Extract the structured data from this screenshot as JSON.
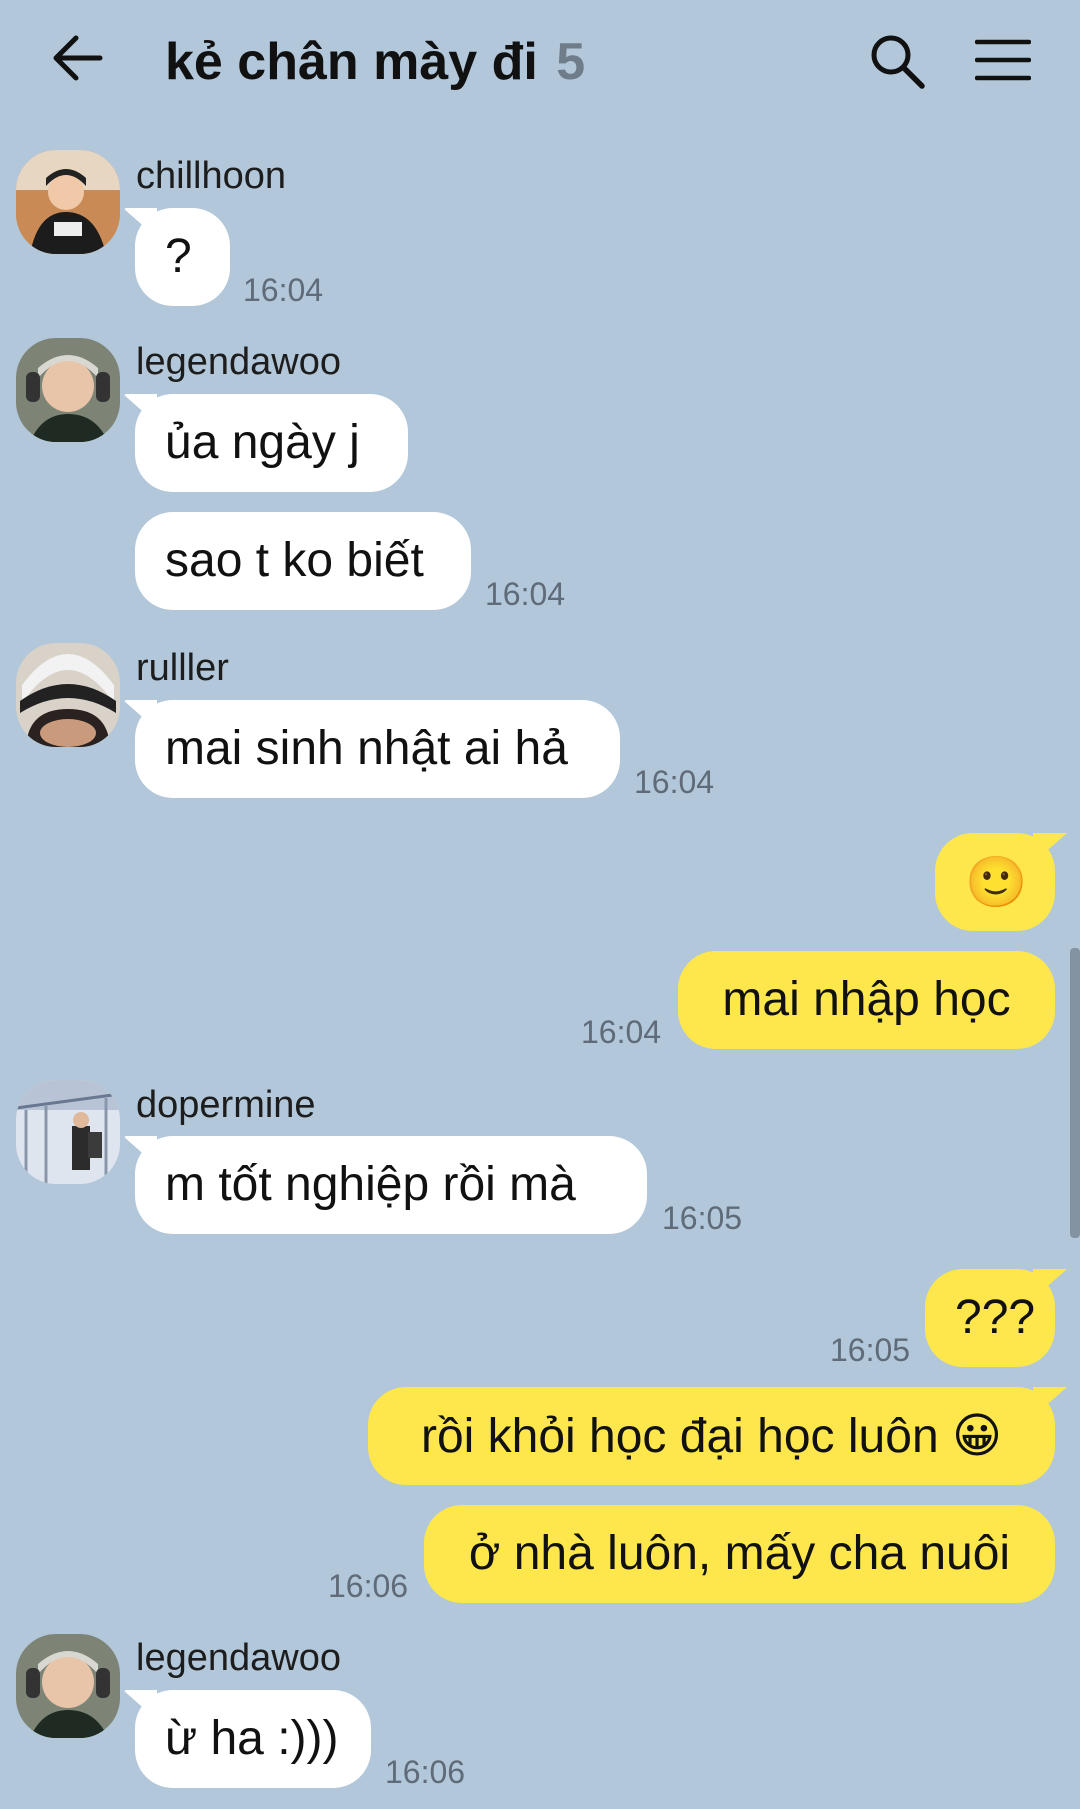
{
  "header": {
    "title": "kẻ chân mày đi",
    "member_count": "5",
    "icons": [
      "back-arrow-icon",
      "search-icon",
      "menu-icon"
    ]
  },
  "messages": {
    "m1": {
      "sender": "chillhoon",
      "text": "?",
      "time": "16:04"
    },
    "m2": {
      "sender": "legendawoo",
      "text1": "ủa ngày j",
      "text2": "sao t ko biết",
      "time": "16:04"
    },
    "m3": {
      "sender": "rulller",
      "text": "mai sinh nhật ai hả",
      "time": "16:04"
    },
    "m4": {
      "emoji": "🙂",
      "text": "mai nhập học",
      "time": "16:04"
    },
    "m5": {
      "sender": "dopermine",
      "text": "m tốt nghiệp rồi mà",
      "time": "16:05"
    },
    "m6": {
      "text": "???",
      "time": "16:05"
    },
    "m7": {
      "text1": "rồi khỏi học đại học luôn",
      "emoji": "😀",
      "text2": "ở nhà luôn, mấy cha nuôi",
      "time": "16:06"
    },
    "m8": {
      "sender": "legendawoo",
      "text": "ừ ha :)))",
      "time": "16:06"
    }
  },
  "colors": {
    "background": "#b2c7d9",
    "incoming_bubble": "#ffffff",
    "outgoing_bubble": "#fde74c",
    "timestamp": "#5f6b78"
  }
}
